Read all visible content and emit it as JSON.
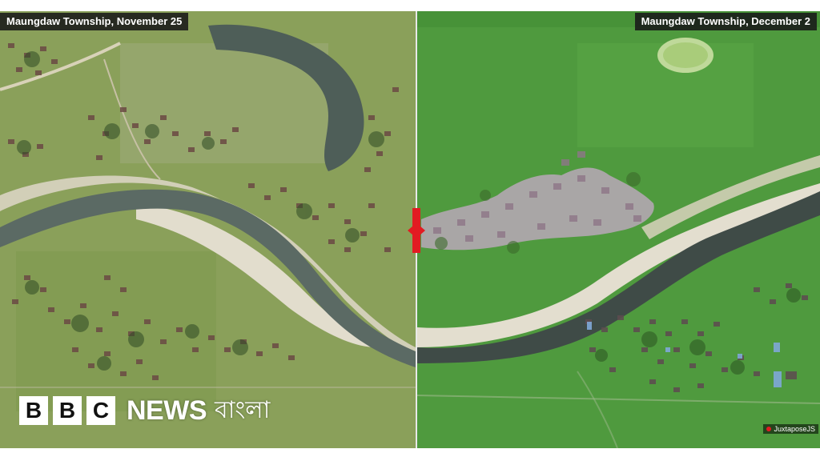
{
  "comparison": {
    "left_label": "Maungdaw Township, November 25",
    "right_label": "Maungdaw Township, December 2",
    "handle_color": "#e21b22"
  },
  "branding": {
    "bbc_letters": [
      "B",
      "B",
      "C"
    ],
    "news": "NEWS",
    "language": "বাংলা"
  },
  "credit": "JuxtaposeJS",
  "colors": {
    "river": "#5a6a63",
    "sandbank": "#d9d4c2",
    "field_left": "#8da25c",
    "field_right": "#4f9a3e",
    "burned_area": "#b9a8b8"
  },
  "icons": {
    "slider_handle": "red-slider-handle-icon"
  }
}
